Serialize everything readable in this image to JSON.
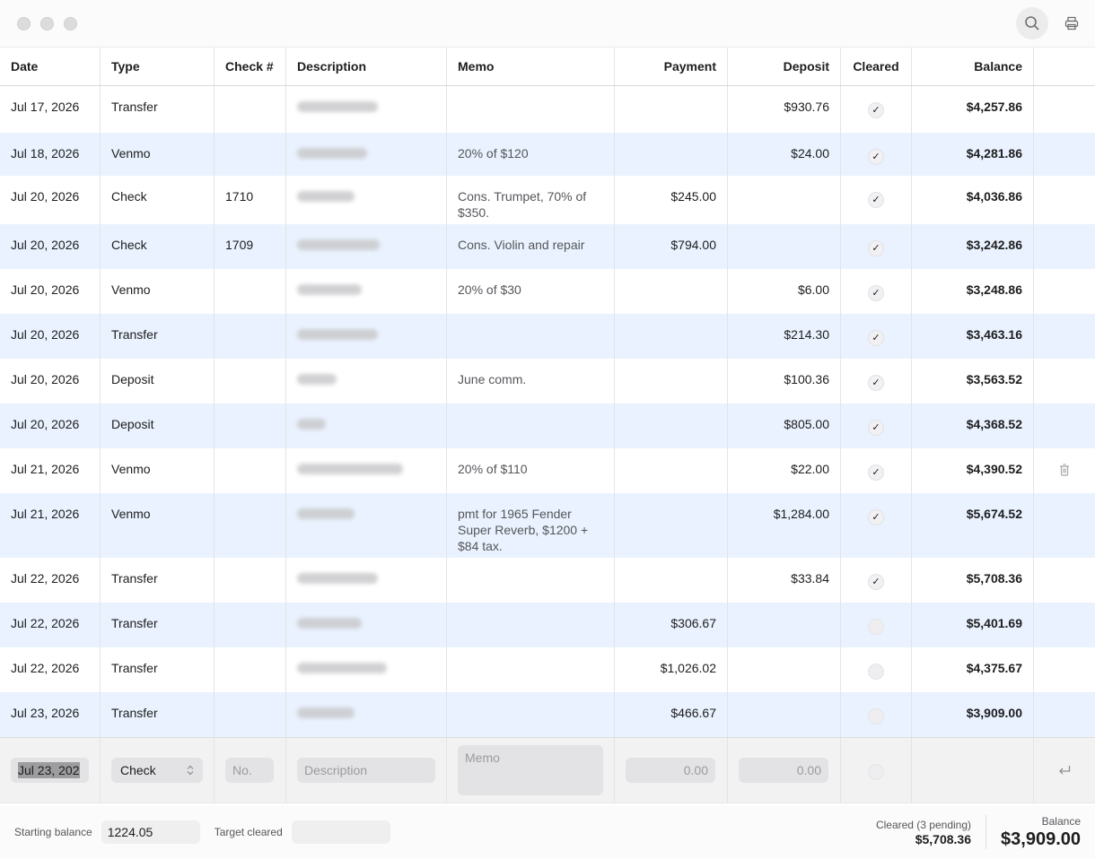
{
  "toolbar": {
    "search_icon": "search-icon",
    "print_icon": "print-icon"
  },
  "columns": [
    "Date",
    "Type",
    "Check #",
    "Description",
    "Memo",
    "Payment",
    "Deposit",
    "Cleared",
    "Balance"
  ],
  "rows": [
    {
      "date": "Jul 17, 2026",
      "type": "Transfer",
      "check": "",
      "memo": "",
      "payment": "",
      "deposit": "$930.76",
      "cleared": true,
      "balance": "$4,257.86",
      "desc_w": 90
    },
    {
      "date": "Jul 18, 2026",
      "type": "Venmo",
      "check": "",
      "memo": "20% of $120",
      "payment": "",
      "deposit": "$24.00",
      "cleared": true,
      "balance": "$4,281.86",
      "desc_w": 78
    },
    {
      "date": "Jul 20, 2026",
      "type": "Check",
      "check": "1710",
      "memo": "Cons. Trumpet, 70% of $350.",
      "payment": "$245.00",
      "deposit": "",
      "cleared": true,
      "balance": "$4,036.86",
      "desc_w": 64
    },
    {
      "date": "Jul 20, 2026",
      "type": "Check",
      "check": "1709",
      "memo": "Cons. Violin and repair",
      "payment": "$794.00",
      "deposit": "",
      "cleared": true,
      "balance": "$3,242.86",
      "desc_w": 92
    },
    {
      "date": "Jul 20, 2026",
      "type": "Venmo",
      "check": "",
      "memo": "20% of $30",
      "payment": "",
      "deposit": "$6.00",
      "cleared": true,
      "balance": "$3,248.86",
      "desc_w": 72
    },
    {
      "date": "Jul 20, 2026",
      "type": "Transfer",
      "check": "",
      "memo": "",
      "payment": "",
      "deposit": "$214.30",
      "cleared": true,
      "balance": "$3,463.16",
      "desc_w": 90
    },
    {
      "date": "Jul 20, 2026",
      "type": "Deposit",
      "check": "",
      "memo": "June comm.",
      "payment": "",
      "deposit": "$100.36",
      "cleared": true,
      "balance": "$3,563.52",
      "desc_w": 44
    },
    {
      "date": "Jul 20, 2026",
      "type": "Deposit",
      "check": "",
      "memo": "",
      "payment": "",
      "deposit": "$805.00",
      "cleared": true,
      "balance": "$4,368.52",
      "desc_w": 32
    },
    {
      "date": "Jul 21, 2026",
      "type": "Venmo",
      "check": "",
      "memo": "20% of $110",
      "payment": "",
      "deposit": "$22.00",
      "cleared": true,
      "balance": "$4,390.52",
      "desc_w": 118,
      "trash": true
    },
    {
      "date": "Jul 21, 2026",
      "type": "Venmo",
      "check": "",
      "memo": "pmt for 1965 Fender Super Reverb, $1200 + $84 tax.",
      "payment": "",
      "deposit": "$1,284.00",
      "cleared": true,
      "balance": "$5,674.52",
      "desc_w": 64
    },
    {
      "date": "Jul 22, 2026",
      "type": "Transfer",
      "check": "",
      "memo": "",
      "payment": "",
      "deposit": "$33.84",
      "cleared": true,
      "balance": "$5,708.36",
      "desc_w": 90
    },
    {
      "date": "Jul 22, 2026",
      "type": "Transfer",
      "check": "",
      "memo": "",
      "payment": "$306.67",
      "deposit": "",
      "cleared": false,
      "balance": "$5,401.69",
      "desc_w": 72
    },
    {
      "date": "Jul 22, 2026",
      "type": "Transfer",
      "check": "",
      "memo": "",
      "payment": "$1,026.02",
      "deposit": "",
      "cleared": false,
      "balance": "$4,375.67",
      "desc_w": 100
    },
    {
      "date": "Jul 23, 2026",
      "type": "Transfer",
      "check": "",
      "memo": "",
      "payment": "$466.67",
      "deposit": "",
      "cleared": false,
      "balance": "$3,909.00",
      "desc_w": 64
    }
  ],
  "entry": {
    "date_value": "Jul 23, 202",
    "type_value": "Check",
    "check_placeholder": "No.",
    "description_placeholder": "Description",
    "memo_placeholder": "Memo",
    "payment_placeholder": "0.00",
    "deposit_placeholder": "0.00",
    "enter_icon": "return-icon"
  },
  "footer": {
    "starting_balance_label": "Starting balance",
    "starting_balance_value": "1224.05",
    "target_cleared_label": "Target cleared",
    "target_cleared_value": "",
    "cleared_label": "Cleared (3 pending)",
    "cleared_value": "$5,708.36",
    "balance_label": "Balance",
    "balance_value": "$3,909.00"
  }
}
